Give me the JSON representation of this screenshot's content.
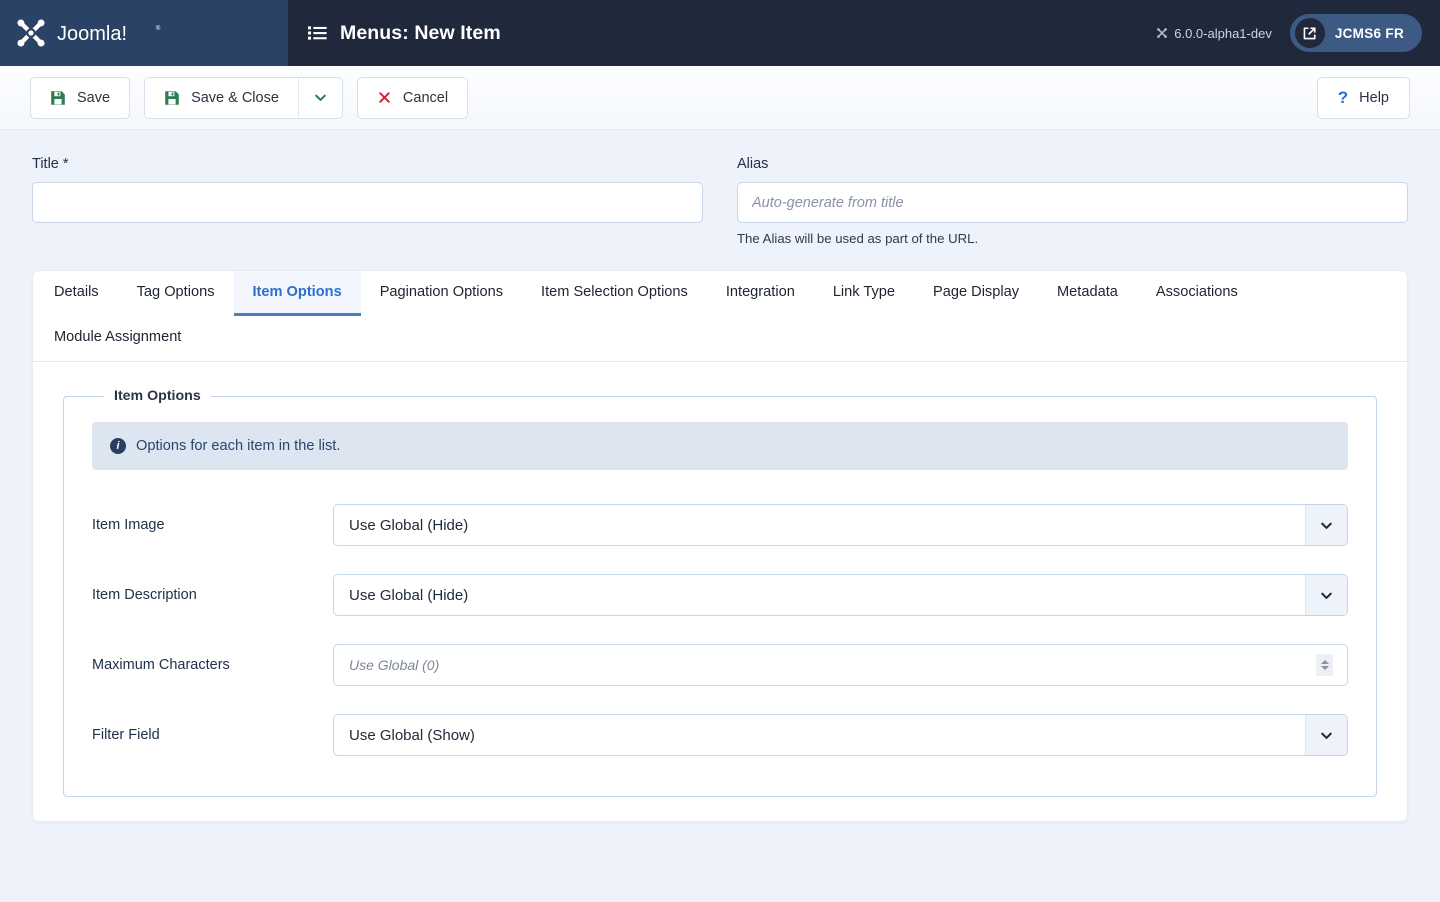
{
  "header": {
    "brand_name": "Joomla!",
    "brand_logo_icon": "joomla-logo-icon",
    "menu_icon": "list-icon",
    "page_title": "Menus: New Item",
    "version": "6.0.0-alpha1-dev",
    "version_icon": "joomla-mark-icon",
    "user_label": "JCMS6 FR",
    "user_icon": "external-link-icon"
  },
  "toolbar": {
    "save_label": "Save",
    "save_icon": "floppy-disk-icon",
    "save_close_label": "Save & Close",
    "save_close_icon": "floppy-disk-icon",
    "dropdown_icon": "chevron-down-icon",
    "cancel_label": "Cancel",
    "cancel_icon": "close-x-icon",
    "help_label": "Help",
    "help_icon": "question-mark-icon"
  },
  "fields": {
    "title_label": "Title *",
    "title_value": "",
    "title_placeholder": "",
    "alias_label": "Alias",
    "alias_value": "",
    "alias_placeholder": "Auto-generate from title",
    "alias_help": "The Alias will be used as part of the URL."
  },
  "tabs": [
    {
      "label": "Details",
      "active": false
    },
    {
      "label": "Tag Options",
      "active": false
    },
    {
      "label": "Item Options",
      "active": true
    },
    {
      "label": "Pagination Options",
      "active": false
    },
    {
      "label": "Item Selection Options",
      "active": false
    },
    {
      "label": "Integration",
      "active": false
    },
    {
      "label": "Link Type",
      "active": false
    },
    {
      "label": "Page Display",
      "active": false
    },
    {
      "label": "Metadata",
      "active": false
    },
    {
      "label": "Associations",
      "active": false
    },
    {
      "label": "Module Assignment",
      "active": false
    }
  ],
  "panel": {
    "legend": "Item Options",
    "alert_text": "Options for each item in the list.",
    "alert_icon": "info-circle-icon",
    "rows": [
      {
        "label": "Item Image",
        "type": "select",
        "value": "Use Global (Hide)",
        "icon": "chevron-down-icon"
      },
      {
        "label": "Item Description",
        "type": "select",
        "value": "Use Global (Hide)",
        "icon": "chevron-down-icon"
      },
      {
        "label": "Maximum Characters",
        "type": "number",
        "value": "",
        "placeholder": "Use Global (0)",
        "icon": "spinner-icon"
      },
      {
        "label": "Filter Field",
        "type": "select",
        "value": "Use Global (Show)",
        "icon": "chevron-down-icon"
      }
    ]
  },
  "colors": {
    "header_bg": "#20293c",
    "brand_bg": "#2a4266",
    "page_bg": "#edf2fb",
    "accent": "#2c6ecb",
    "save_green": "#2e7d4f",
    "cancel_red": "#cc2233",
    "alert_bg": "#dde5f1"
  }
}
